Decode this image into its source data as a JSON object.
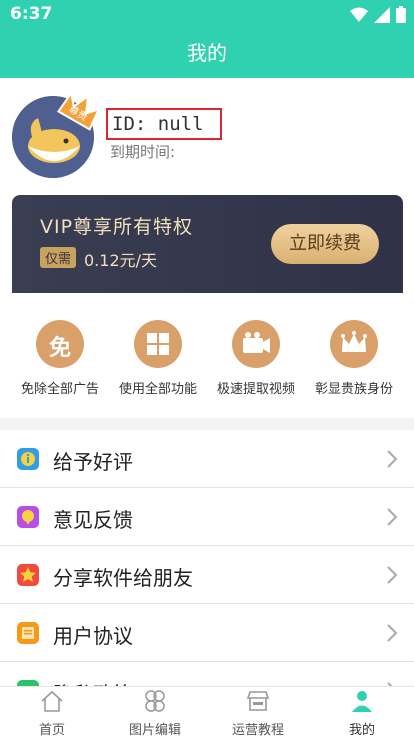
{
  "status_bar": {
    "time": "6:37"
  },
  "app_bar": {
    "title": "我的"
  },
  "profile": {
    "crown_badge": "尊贵",
    "id_text": "ID: null",
    "expire_label": "到期时间:"
  },
  "vip_card": {
    "title": "VIP尊享所有特权",
    "tag": "仅需",
    "price": "0.12元/天",
    "renew_label": "立即续费"
  },
  "features": [
    {
      "label": "免除全部广告",
      "icon": "free-icon",
      "glyph": "免"
    },
    {
      "label": "使用全部功能",
      "icon": "grid-icon"
    },
    {
      "label": "极速提取视频",
      "icon": "video-camera-icon"
    },
    {
      "label": "彰显贵族身份",
      "icon": "crown-icon"
    }
  ],
  "menu": [
    {
      "label": "给予好评",
      "icon": "info-icon",
      "color": "#2f9ee8"
    },
    {
      "label": "意见反馈",
      "icon": "feedback-icon",
      "color": "#b74ee6"
    },
    {
      "label": "分享软件给朋友",
      "icon": "star-icon",
      "color": "#f04b3c"
    },
    {
      "label": "用户协议",
      "icon": "document-icon",
      "color": "#f39a1c"
    },
    {
      "label": "隐私政策",
      "icon": "privacy-icon",
      "color": "#2cc16a"
    }
  ],
  "bottom_nav": [
    {
      "label": "首页",
      "icon": "home-icon"
    },
    {
      "label": "图片编辑",
      "icon": "clover-icon"
    },
    {
      "label": "运营教程",
      "icon": "store-icon"
    },
    {
      "label": "我的",
      "icon": "person-icon",
      "active": true
    }
  ],
  "colors": {
    "accent": "#2fd1b0",
    "vip_gold": "#d9b071",
    "feature_icon": "#d9a06a"
  }
}
